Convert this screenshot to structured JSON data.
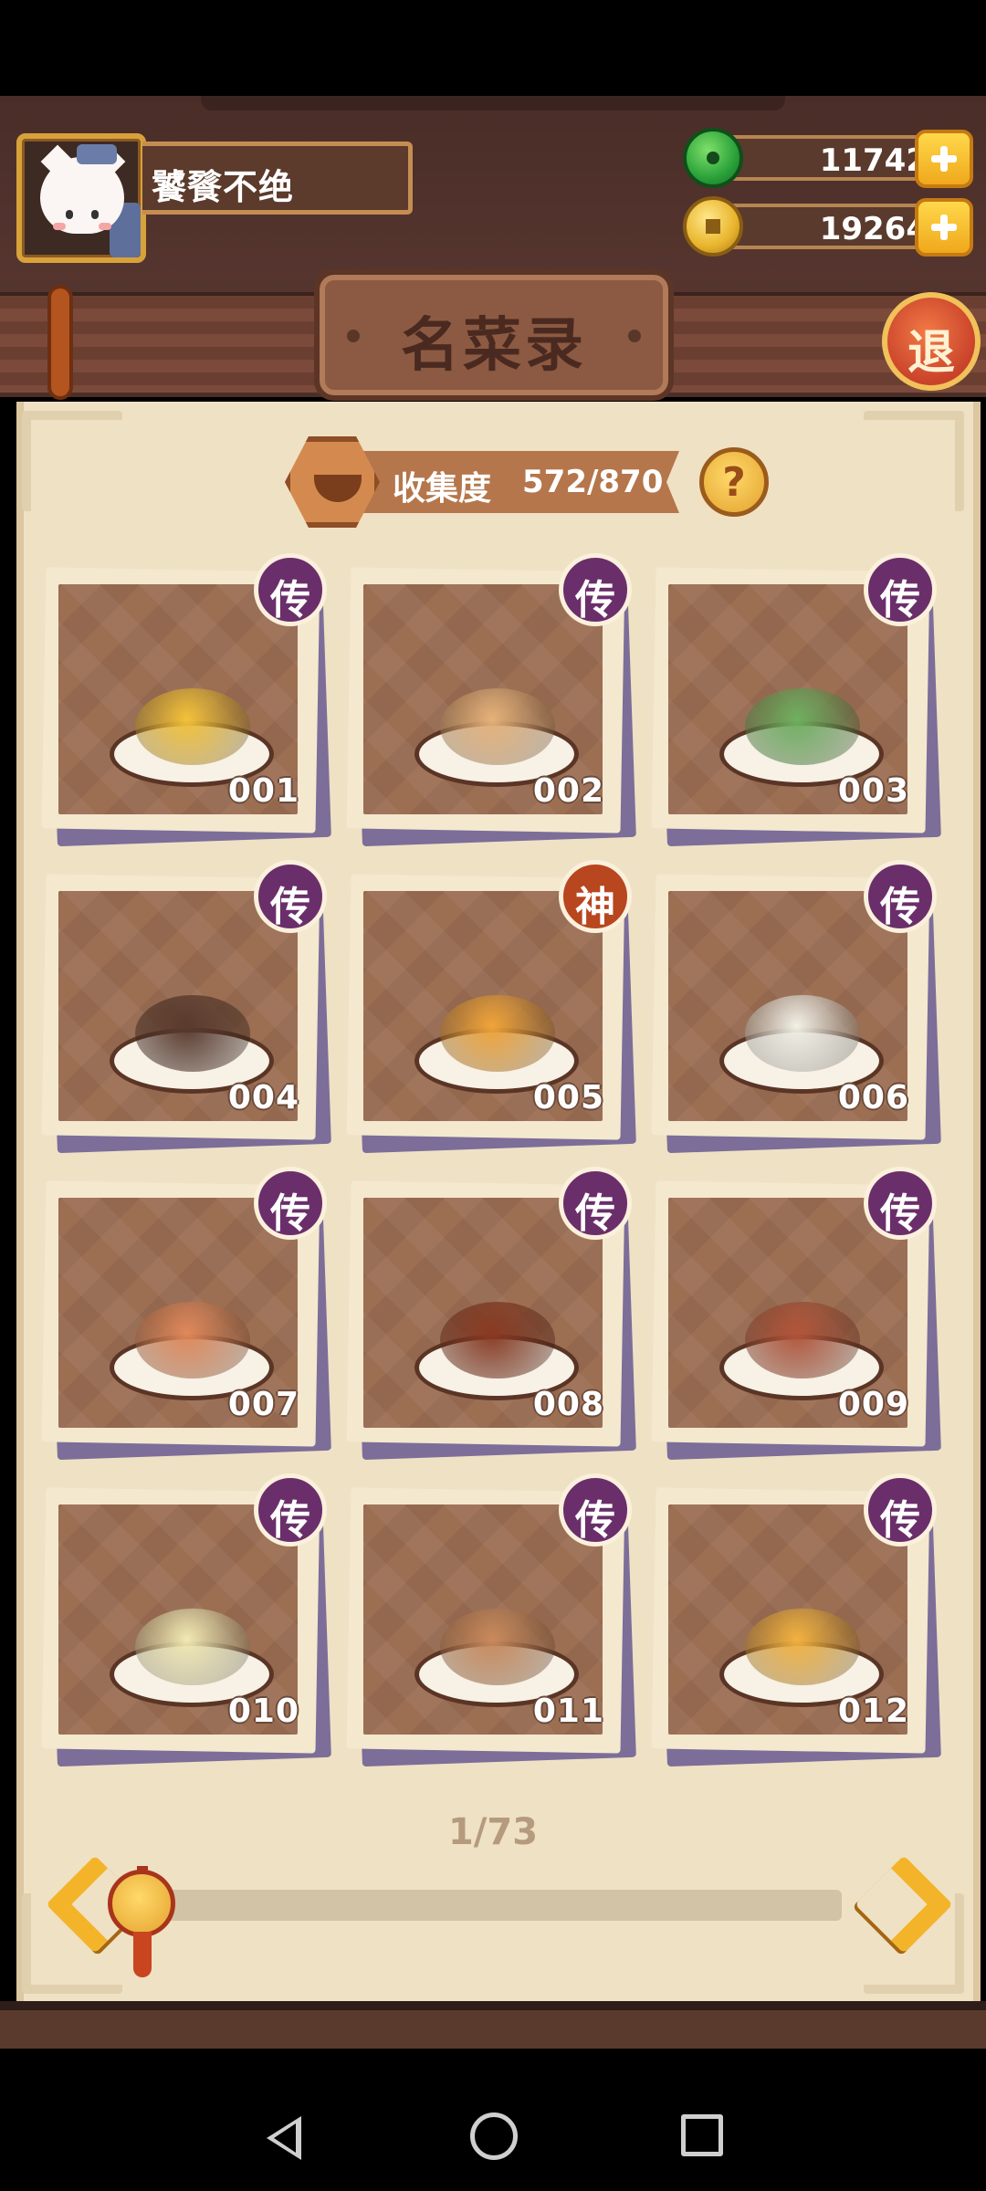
{
  "player": {
    "name": "饕餮不绝"
  },
  "currency": {
    "jade": "11742",
    "gold": "19264"
  },
  "title": "名菜录",
  "exit_label": "退",
  "collection": {
    "label": "收集度",
    "value": "572/870"
  },
  "help_label": "?",
  "dishes": [
    {
      "number": "001",
      "badge": "传",
      "tier": "legend",
      "food_color": "#f3c23a"
    },
    {
      "number": "002",
      "badge": "传",
      "tier": "legend",
      "food_color": "#e6b27a"
    },
    {
      "number": "003",
      "badge": "传",
      "tier": "legend",
      "food_color": "#6fb060"
    },
    {
      "number": "004",
      "badge": "传",
      "tier": "legend",
      "food_color": "#5a3a2e"
    },
    {
      "number": "005",
      "badge": "神",
      "tier": "divine",
      "food_color": "#f0a43a"
    },
    {
      "number": "006",
      "badge": "传",
      "tier": "legend",
      "food_color": "#f2f0e6"
    },
    {
      "number": "007",
      "badge": "传",
      "tier": "legend",
      "food_color": "#e0885a"
    },
    {
      "number": "008",
      "badge": "传",
      "tier": "legend",
      "food_color": "#8a3a22"
    },
    {
      "number": "009",
      "badge": "传",
      "tier": "legend",
      "food_color": "#b2553a"
    },
    {
      "number": "010",
      "badge": "传",
      "tier": "legend",
      "food_color": "#f1e9b4"
    },
    {
      "number": "011",
      "badge": "传",
      "tier": "legend",
      "food_color": "#c98a5c"
    },
    {
      "number": "012",
      "badge": "传",
      "tier": "legend",
      "food_color": "#f2b240"
    }
  ],
  "pagination": {
    "current": 1,
    "total": 73,
    "label": "1/73"
  },
  "colors": {
    "legend_badge": "#6a2f6a",
    "divine_badge": "#b8461f",
    "accent_gold": "#f4b42a"
  },
  "icons": {
    "jade": "jade-coin-icon",
    "gold": "gold-coin-icon",
    "add": "plus-icon",
    "collection": "bowl-icon",
    "prev": "chevron-left-icon",
    "next": "chevron-right-icon"
  }
}
